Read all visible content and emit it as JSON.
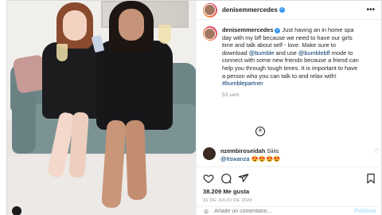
{
  "post": {
    "username": "denisemmercedes",
    "verified_icon": "verified-icon",
    "more_label": "•••"
  },
  "caption": {
    "username": "denisemmercedes",
    "text_parts": [
      " Just having an in home spa day with my bff because we need to have our girls time and talk about self - love. Make sure to download ",
      "@bumble",
      " and use ",
      "@bumblebff",
      " mode to connect with some new friends because a friend can help you through tough times. It is important to have a person who you can talk to and relax with! ",
      "#bumblepartner"
    ],
    "time_ago": "53 sem"
  },
  "comments": [
    {
      "username": "nzembiroseidah",
      "text": " Siiiis",
      "mention": "@Itswanza",
      "emojis": "😍😍😍😍"
    }
  ],
  "actions": {
    "likes_count": "38.209",
    "likes_label": "Me gusta",
    "date": "31 DE JULIO DE 2020"
  },
  "add_comment": {
    "placeholder": "Añade un comentario...",
    "publish_label": "Publicar"
  },
  "colors": {
    "link": "#00376b",
    "verified": "#3897f0",
    "muted": "#8e8e8e"
  }
}
